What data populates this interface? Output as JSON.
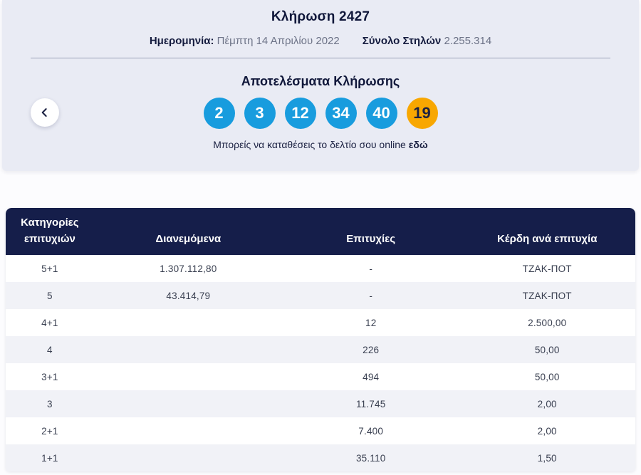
{
  "header": {
    "title": "Κλήρωση 2427",
    "date_label": "Ημερομηνία:",
    "date_value": "Πέμπτη 14 Απριλίου 2022",
    "columns_label": "Σύνολο Στηλών",
    "columns_value": "2.255.314"
  },
  "results": {
    "title": "Αποτελέσματα Κλήρωσης",
    "numbers": [
      "2",
      "3",
      "12",
      "34",
      "40"
    ],
    "bonus_number": "19",
    "online_text_prefix": "Μπορείς να καταθέσεις το δελτίο σου online",
    "online_link_label": "εδώ"
  },
  "nav": {
    "back_icon": "chevron-left"
  },
  "colors": {
    "panel_bg": "#e9ebf4",
    "ball_blue": "#189cde",
    "ball_bonus_orange": "#f8a701",
    "table_header_navy": "#151e4a",
    "row_alt_bg": "#f1f2f7"
  },
  "table": {
    "headers": [
      "Κατηγορίες επιτυχιών",
      "Διανεμόμενα",
      "Επιτυχίες",
      "Κέρδη ανά επιτυχία"
    ],
    "rows": [
      {
        "category": "5+1",
        "distributed": "1.307.112,80",
        "wins": "-",
        "prize": "ΤΖΑΚ-ΠΟΤ"
      },
      {
        "category": "5",
        "distributed": "43.414,79",
        "wins": "-",
        "prize": "ΤΖΑΚ-ΠΟΤ"
      },
      {
        "category": "4+1",
        "distributed": "",
        "wins": "12",
        "prize": "2.500,00"
      },
      {
        "category": "4",
        "distributed": "",
        "wins": "226",
        "prize": "50,00"
      },
      {
        "category": "3+1",
        "distributed": "",
        "wins": "494",
        "prize": "50,00"
      },
      {
        "category": "3",
        "distributed": "",
        "wins": "11.745",
        "prize": "2,00"
      },
      {
        "category": "2+1",
        "distributed": "",
        "wins": "7.400",
        "prize": "2,00"
      },
      {
        "category": "1+1",
        "distributed": "",
        "wins": "35.110",
        "prize": "1,50"
      }
    ]
  }
}
